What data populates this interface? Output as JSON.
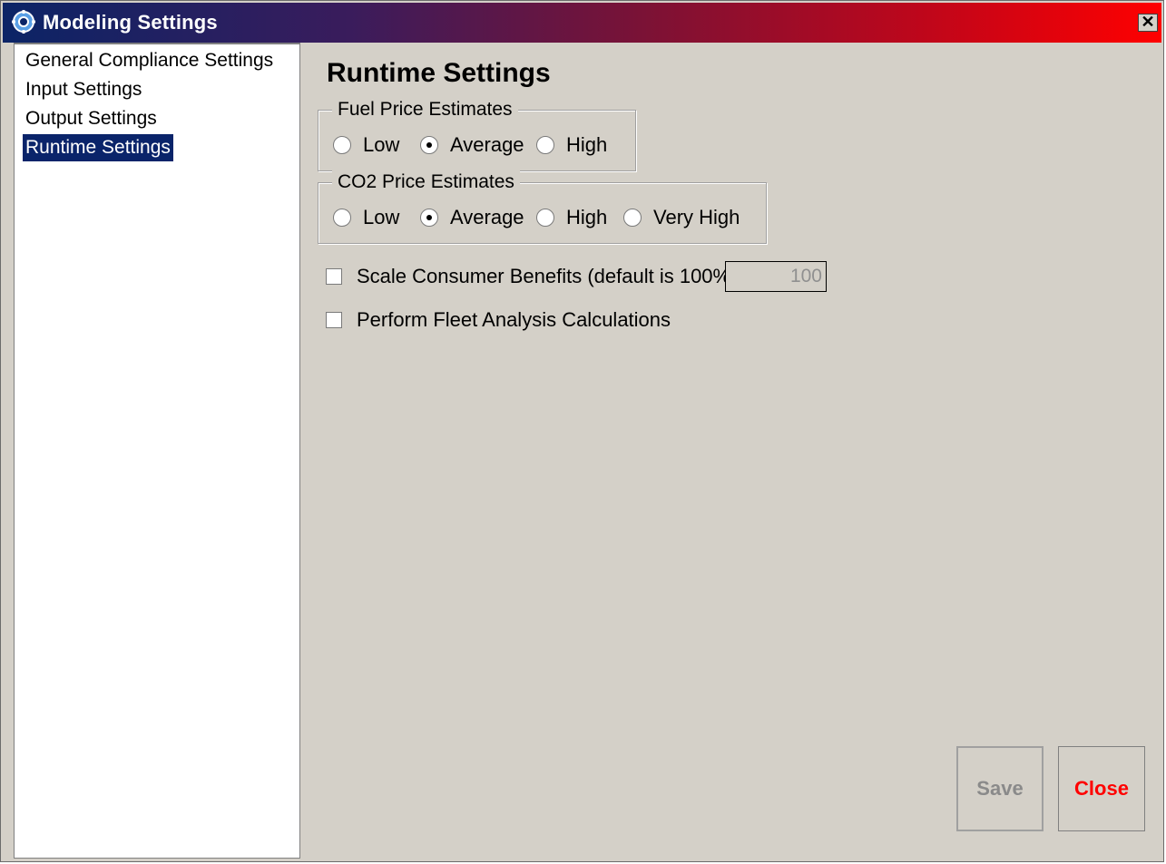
{
  "window": {
    "title": "Modeling Settings",
    "close_glyph": "✕"
  },
  "sidebar": {
    "items": [
      {
        "label": "General Compliance Settings",
        "selected": false
      },
      {
        "label": "Input Settings",
        "selected": false
      },
      {
        "label": "Output Settings",
        "selected": false
      },
      {
        "label": "Runtime Settings",
        "selected": true
      }
    ]
  },
  "main": {
    "title": "Runtime Settings",
    "fuel_price": {
      "legend": "Fuel Price Estimates",
      "options": [
        "Low",
        "Average",
        "High"
      ],
      "selected": "Average"
    },
    "co2_price": {
      "legend": "CO2 Price Estimates",
      "options": [
        "Low",
        "Average",
        "High",
        "Very High"
      ],
      "selected": "Average"
    },
    "scale_benefits": {
      "label": "Scale Consumer Benefits (default is 100%):",
      "checked": false,
      "value": "100"
    },
    "fleet_analysis": {
      "label": "Perform Fleet Analysis Calculations",
      "checked": false
    }
  },
  "buttons": {
    "save_label": "Save",
    "close_label": "Close"
  },
  "colors": {
    "selection": "#0a246a",
    "close_text": "#ff0000",
    "disabled_text": "#8a8a8a"
  }
}
